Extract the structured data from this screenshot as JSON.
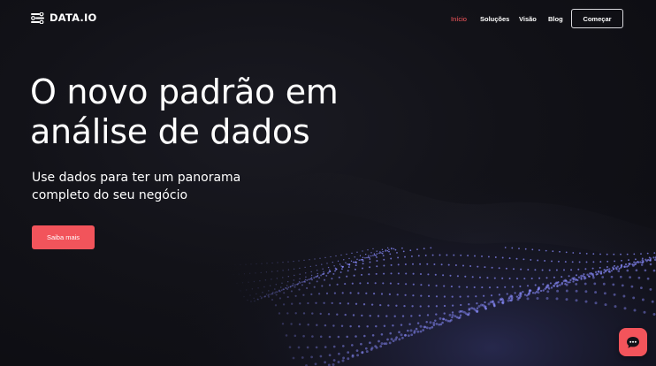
{
  "brand": {
    "name": "DATA.IO",
    "logo_icon": "sliders-logo-icon"
  },
  "nav": {
    "items": [
      {
        "label": "Início",
        "active": true
      },
      {
        "label": "Soluções",
        "active": false
      },
      {
        "label": "Visão",
        "active": false
      },
      {
        "label": "Blog",
        "active": false
      }
    ],
    "cta_label": "Começar"
  },
  "hero": {
    "title_line1": "O novo padrão em",
    "title_line2": "análise de dados",
    "subtitle_line1": "Use dados para ter um panorama",
    "subtitle_line2": "completo do seu negócio",
    "button_label": "Saiba mais"
  },
  "chat": {
    "icon": "chat-bubble-icon"
  },
  "colors": {
    "accent": "#f2545b",
    "nav_active": "#ff5a5f",
    "background": "#121218",
    "wave_dots": "#8a8cff"
  }
}
